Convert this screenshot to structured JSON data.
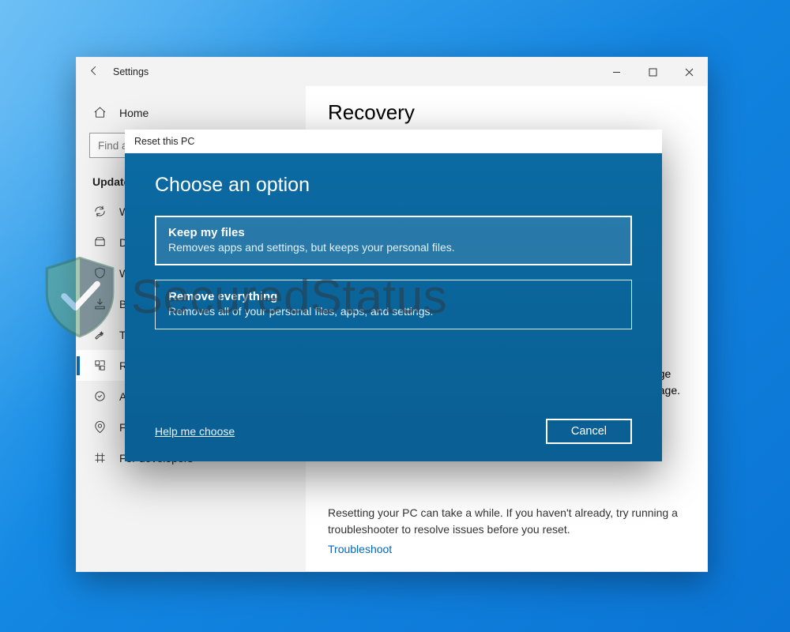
{
  "window": {
    "title": "Settings",
    "controls": {
      "minimize": "–",
      "maximize": "□",
      "close": "×"
    }
  },
  "sidebar": {
    "home": "Home",
    "search_placeholder": "Find a setting",
    "section": "Update & Security",
    "items": [
      {
        "icon": "sync-icon",
        "label": "Windows Update"
      },
      {
        "icon": "delivery-icon",
        "label": "Delivery Optimization"
      },
      {
        "icon": "shield-icon",
        "label": "Windows Security"
      },
      {
        "icon": "backup-icon",
        "label": "Backup"
      },
      {
        "icon": "troubleshoot-icon",
        "label": "Troubleshoot"
      },
      {
        "icon": "recovery-icon",
        "label": "Recovery",
        "selected": true
      },
      {
        "icon": "activation-icon",
        "label": "Activation"
      },
      {
        "icon": "findmydevice-icon",
        "label": "Find my device"
      },
      {
        "icon": "developers-icon",
        "label": "For developers"
      }
    ]
  },
  "content": {
    "title": "Recovery",
    "note_line1": "Resetting your PC can take a while. If you haven't already, try running a troubleshooter to resolve issues before you reset.",
    "troubleshoot_link": "Troubleshoot",
    "hidden_text_1": "ge",
    "hidden_text_2": "age."
  },
  "dialog": {
    "window_title": "Reset this PC",
    "heading": "Choose an option",
    "options": [
      {
        "title": "Keep my files",
        "desc": "Removes apps and settings, but keeps your personal files."
      },
      {
        "title": "Remove everything",
        "desc": "Removes all of your personal files, apps, and settings."
      }
    ],
    "help_link": "Help me choose",
    "cancel": "Cancel"
  },
  "watermark": {
    "text": "SecuredStatus"
  }
}
